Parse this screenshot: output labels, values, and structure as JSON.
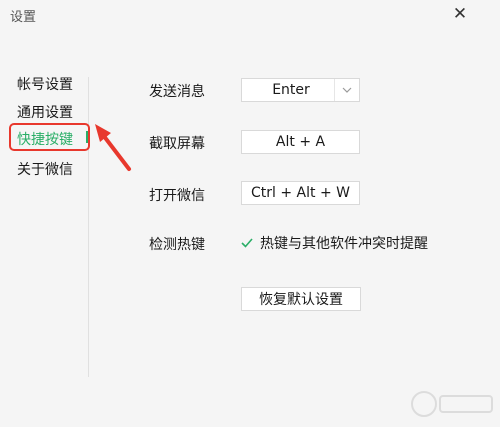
{
  "window": {
    "title": "设置"
  },
  "sidebar": {
    "items": [
      {
        "label": "帐号设置"
      },
      {
        "label": "通用设置"
      },
      {
        "label": "快捷按键"
      },
      {
        "label": "关于微信"
      }
    ]
  },
  "shortcuts": {
    "send_message": {
      "label": "发送消息",
      "value": "Enter"
    },
    "screenshot": {
      "label": "截取屏幕",
      "value": "Alt + A"
    },
    "open_wechat": {
      "label": "打开微信",
      "value": "Ctrl + Alt + W"
    },
    "detect_hotkeys": {
      "label": "检测热键",
      "checkbox_label": "热键与其他软件冲突时提醒",
      "checked": true
    },
    "reset_label": "恢复默认设置"
  },
  "colors": {
    "accent": "#2aae67",
    "annotation": "#e8382d"
  },
  "icons": {
    "close": "close-icon",
    "dropdown": "chevron-down-icon",
    "check": "check-icon"
  }
}
